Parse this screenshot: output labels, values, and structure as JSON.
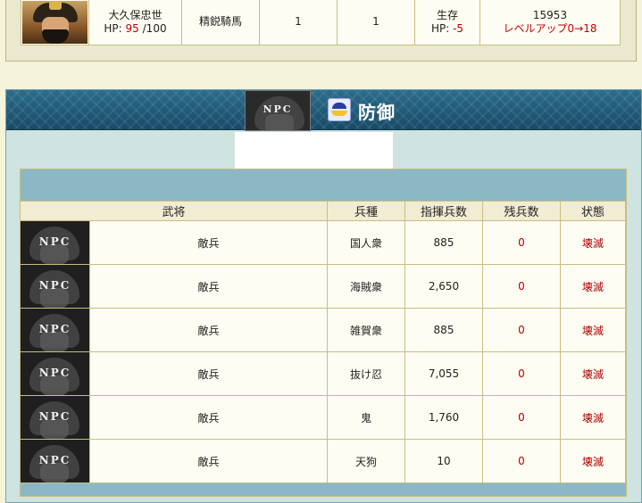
{
  "attacker": {
    "name": "大久保忠世",
    "hp_label": "HP:",
    "hp_current": "95",
    "hp_max": "/100",
    "unit": "精鋭騎馬",
    "count1": "1",
    "count2": "1",
    "status": "生存",
    "status_hp_label": "HP:",
    "status_hp_change": "-5",
    "exp": "15953",
    "levelup": "レベルアップ0→18"
  },
  "defense": {
    "npc_badge": "NPC",
    "title": "防御",
    "columns": [
      "武将",
      "兵種",
      "指揮兵数",
      "残兵数",
      "状態"
    ],
    "rows": [
      {
        "badge": "NPC",
        "name": "敵兵",
        "type": "国人衆",
        "command": "885",
        "remaining": "0",
        "status": "壊滅"
      },
      {
        "badge": "NPC",
        "name": "敵兵",
        "type": "海賊衆",
        "command": "2,650",
        "remaining": "0",
        "status": "壊滅"
      },
      {
        "badge": "NPC",
        "name": "敵兵",
        "type": "雑賀衆",
        "command": "885",
        "remaining": "0",
        "status": "壊滅"
      },
      {
        "badge": "NPC",
        "name": "敵兵",
        "type": "抜け忍",
        "command": "7,055",
        "remaining": "0",
        "status": "壊滅"
      },
      {
        "badge": "NPC",
        "name": "敵兵",
        "type": "鬼",
        "command": "1,760",
        "remaining": "0",
        "status": "壊滅"
      },
      {
        "badge": "NPC",
        "name": "敵兵",
        "type": "天狗",
        "command": "10",
        "remaining": "0",
        "status": "壊滅"
      }
    ]
  },
  "colors": {
    "header_blue": "#1f5a78",
    "panel_bg": "#cfe3e0",
    "red_text": "#c00000",
    "border": "#c9bd80"
  }
}
